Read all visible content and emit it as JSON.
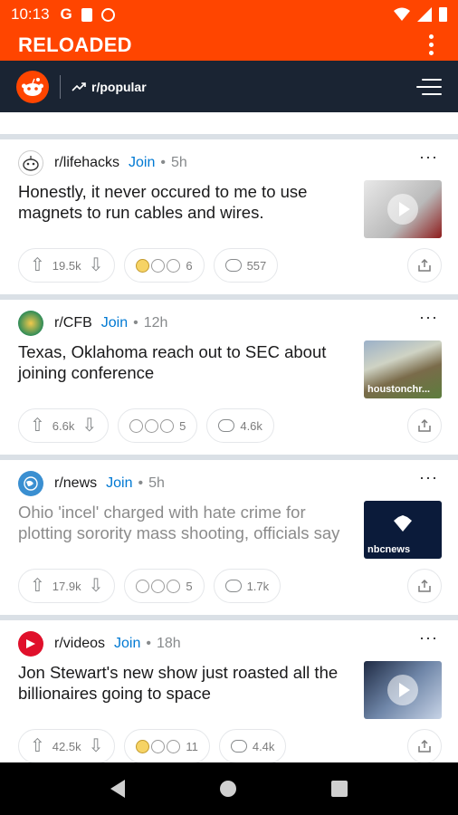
{
  "status_bar": {
    "time": "10:13"
  },
  "app_bar": {
    "title": "RELOADED"
  },
  "nav": {
    "subreddit": "r/popular"
  },
  "posts": [
    {
      "subreddit": "r/lifehacks",
      "join": "Join",
      "age": "5h",
      "title": "Honestly, it never occured to me to use magnets to run cables and wires.",
      "visited": false,
      "thumb_domain": "",
      "thumb_kind": "video",
      "score": "19.5k",
      "awards_count": "6",
      "comments": "557",
      "avatar_color": "#ffffff",
      "thumb_color": "#c9c9c9"
    },
    {
      "subreddit": "r/CFB",
      "join": "Join",
      "age": "12h",
      "title": "Texas, Oklahoma reach out to SEC about joining conference",
      "visited": false,
      "thumb_domain": "houstonchr...",
      "thumb_kind": "image",
      "score": "6.6k",
      "awards_count": "5",
      "comments": "4.6k",
      "avatar_color": "#2e8b57",
      "thumb_color": "#6d8a5a"
    },
    {
      "subreddit": "r/news",
      "join": "Join",
      "age": "5h",
      "title": "Ohio 'incel' charged with hate crime for plotting sorority mass shooting, officials say",
      "visited": true,
      "thumb_domain": "nbcnews",
      "thumb_kind": "image",
      "score": "17.9k",
      "awards_count": "5",
      "comments": "1.7k",
      "avatar_color": "#3a8fd1",
      "thumb_color": "#0b1b3a"
    },
    {
      "subreddit": "r/videos",
      "join": "Join",
      "age": "18h",
      "title": "Jon Stewart's new show just roasted all the billionaires going to space",
      "visited": false,
      "thumb_domain": "",
      "thumb_kind": "video",
      "score": "42.5k",
      "awards_count": "11",
      "comments": "4.4k",
      "avatar_color": "#e0102b",
      "thumb_color": "#3b4c66"
    }
  ],
  "colors": {
    "brand": "#ff4500",
    "navbar": "#1a2433",
    "join": "#0079d3"
  }
}
